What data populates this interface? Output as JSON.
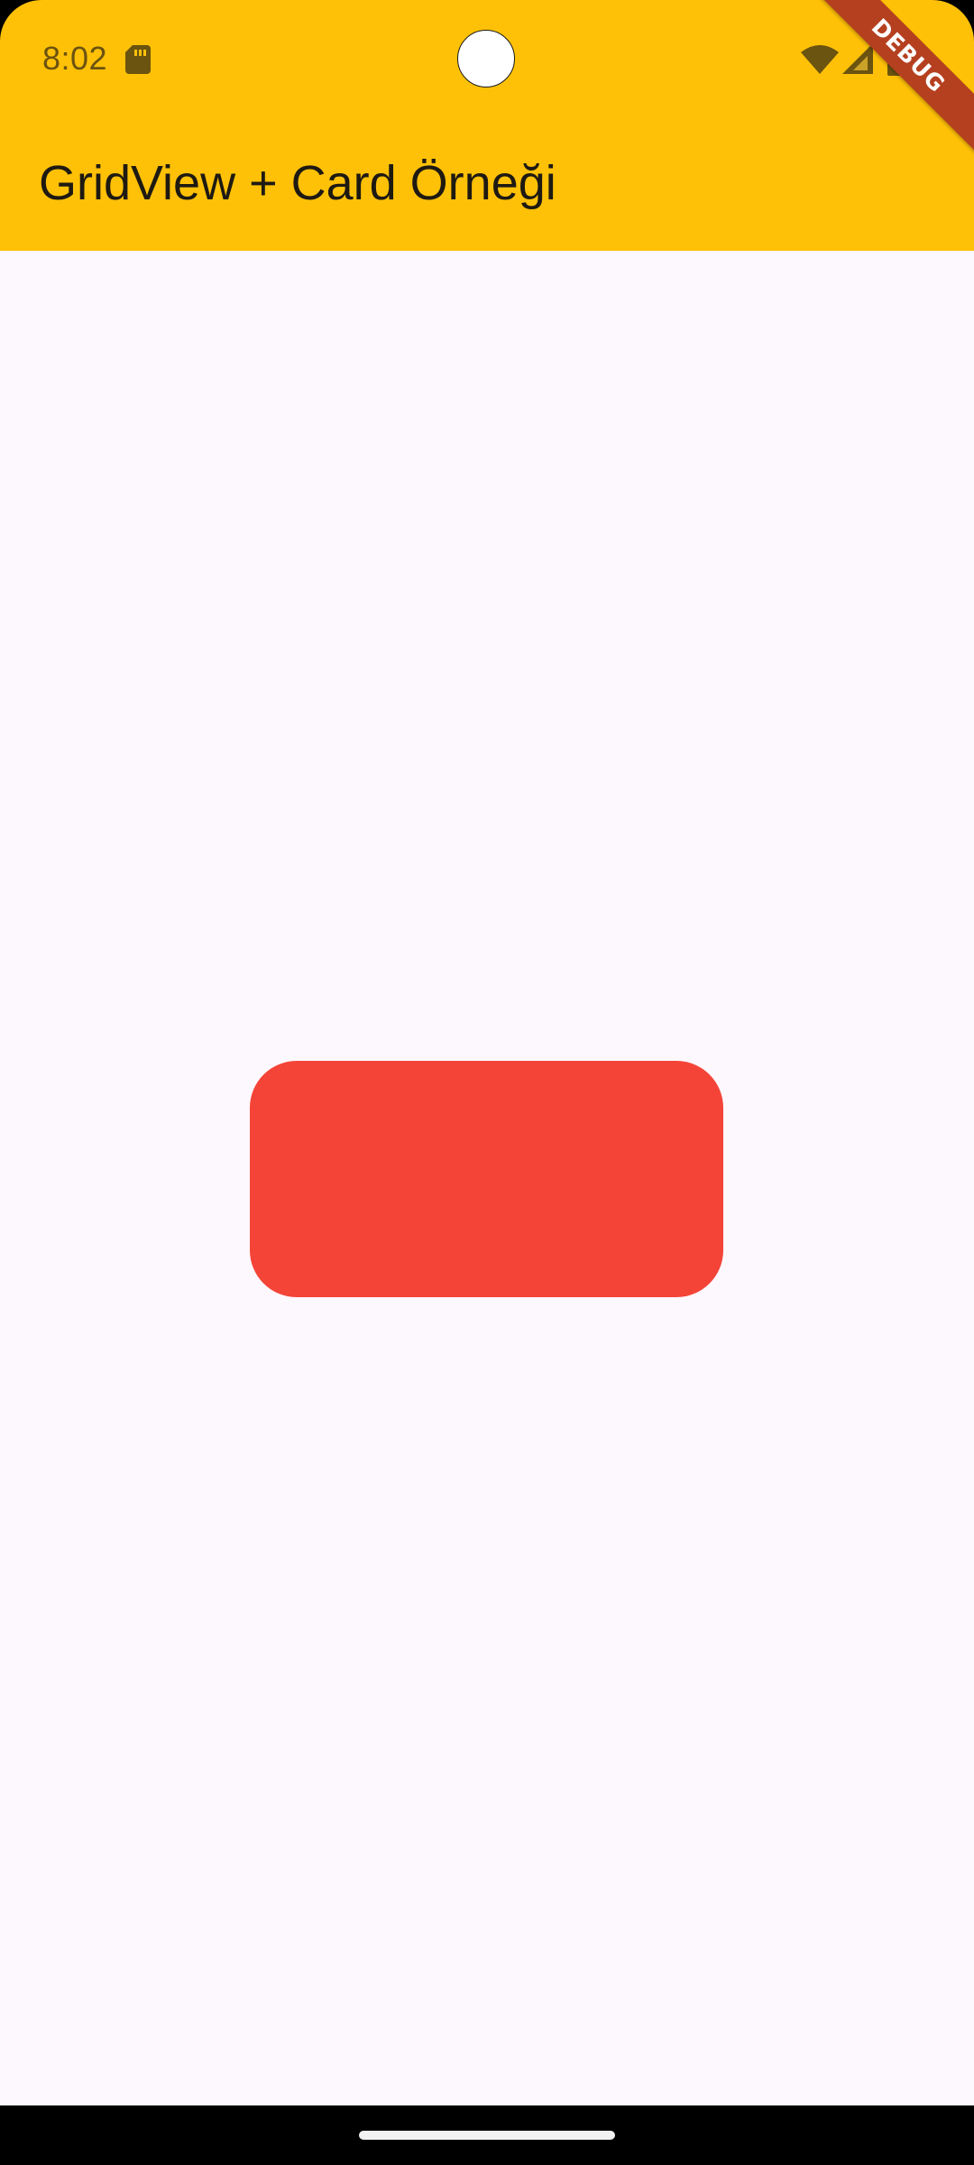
{
  "status_bar": {
    "time": "8:02",
    "icons": [
      "sd-card-icon",
      "wifi-icon",
      "cell-signal-icon",
      "battery-icon"
    ]
  },
  "app_bar": {
    "title": "GridView + Card Örneği",
    "background_color": "#FFC107"
  },
  "debug_banner": {
    "label": "DEBUG"
  },
  "main": {
    "background_color": "#FDF7FE",
    "cards": [
      {
        "color": "#F44438"
      }
    ]
  }
}
